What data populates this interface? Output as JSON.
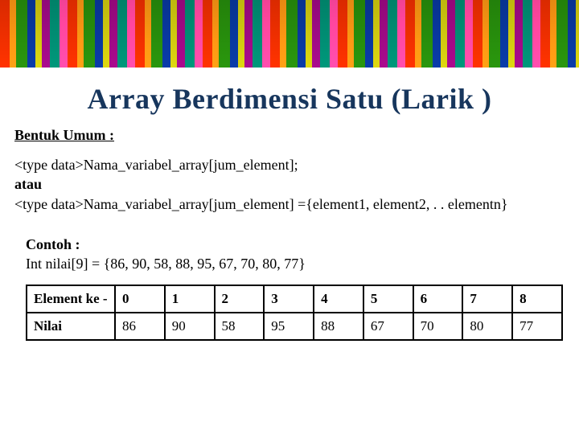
{
  "title": "Array Berdimensi Satu (Larik )",
  "section_label": "Bentuk Umum :",
  "syntax": {
    "line1": "<type data>Nama_variabel_array[jum_element];",
    "or_kw": "atau",
    "line2": "<type data>Nama_variabel_array[jum_element] ={element1, element2, . . elementn}"
  },
  "example": {
    "label": "Contoh :",
    "decl": "Int nilai[9] = {86, 90, 58, 88, 95, 67, 70, 80, 77}"
  },
  "table": {
    "row_header_index": "Element ke -",
    "row_header_value": "Nilai",
    "indices": [
      "0",
      "1",
      "2",
      "3",
      "4",
      "5",
      "6",
      "7",
      "8"
    ],
    "values": [
      "86",
      "90",
      "58",
      "95",
      "88",
      "67",
      "70",
      "80",
      "77"
    ]
  },
  "chart_data": {
    "type": "table",
    "title": "Element ke - / Nilai",
    "columns": [
      "0",
      "1",
      "2",
      "3",
      "4",
      "5",
      "6",
      "7",
      "8"
    ],
    "rows": [
      {
        "name": "Nilai",
        "values": [
          86,
          90,
          58,
          95,
          88,
          67,
          70,
          80,
          77
        ]
      }
    ]
  }
}
